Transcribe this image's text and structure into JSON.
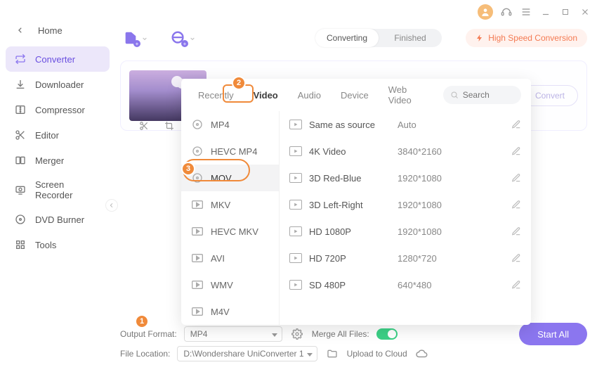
{
  "title_bar": {
    "avatar": "user",
    "headset": "support",
    "menu": "menu"
  },
  "sidebar": {
    "home_label": "Home",
    "items": [
      {
        "label": "Converter"
      },
      {
        "label": "Downloader"
      },
      {
        "label": "Compressor"
      },
      {
        "label": "Editor"
      },
      {
        "label": "Merger"
      },
      {
        "label": "Screen Recorder"
      },
      {
        "label": "DVD Burner"
      },
      {
        "label": "Tools"
      }
    ]
  },
  "toolbar": {
    "segment_converting": "Converting",
    "segment_finished": "Finished",
    "hsc_label": "High Speed Conversion"
  },
  "item": {
    "convert_label": "Convert"
  },
  "popup": {
    "tabs": [
      "Recently",
      "Video",
      "Audio",
      "Device",
      "Web Video"
    ],
    "search_placeholder": "Search",
    "formats": [
      "MP4",
      "HEVC MP4",
      "MOV",
      "MKV",
      "HEVC MKV",
      "AVI",
      "WMV",
      "M4V"
    ],
    "resolutions": [
      {
        "name": "Same as source",
        "dim": "Auto"
      },
      {
        "name": "4K Video",
        "dim": "3840*2160"
      },
      {
        "name": "3D Red-Blue",
        "dim": "1920*1080"
      },
      {
        "name": "3D Left-Right",
        "dim": "1920*1080"
      },
      {
        "name": "HD 1080P",
        "dim": "1920*1080"
      },
      {
        "name": "HD 720P",
        "dim": "1280*720"
      },
      {
        "name": "SD 480P",
        "dim": "640*480"
      }
    ]
  },
  "footer": {
    "output_format_label": "Output Format:",
    "output_format_value": "MP4",
    "merge_label": "Merge All Files:",
    "file_location_label": "File Location:",
    "file_location_value": "D:\\Wondershare UniConverter 1",
    "upload_label": "Upload to Cloud",
    "start_all": "Start All"
  },
  "annotations": {
    "b1": "1",
    "b2": "2",
    "b3": "3"
  }
}
